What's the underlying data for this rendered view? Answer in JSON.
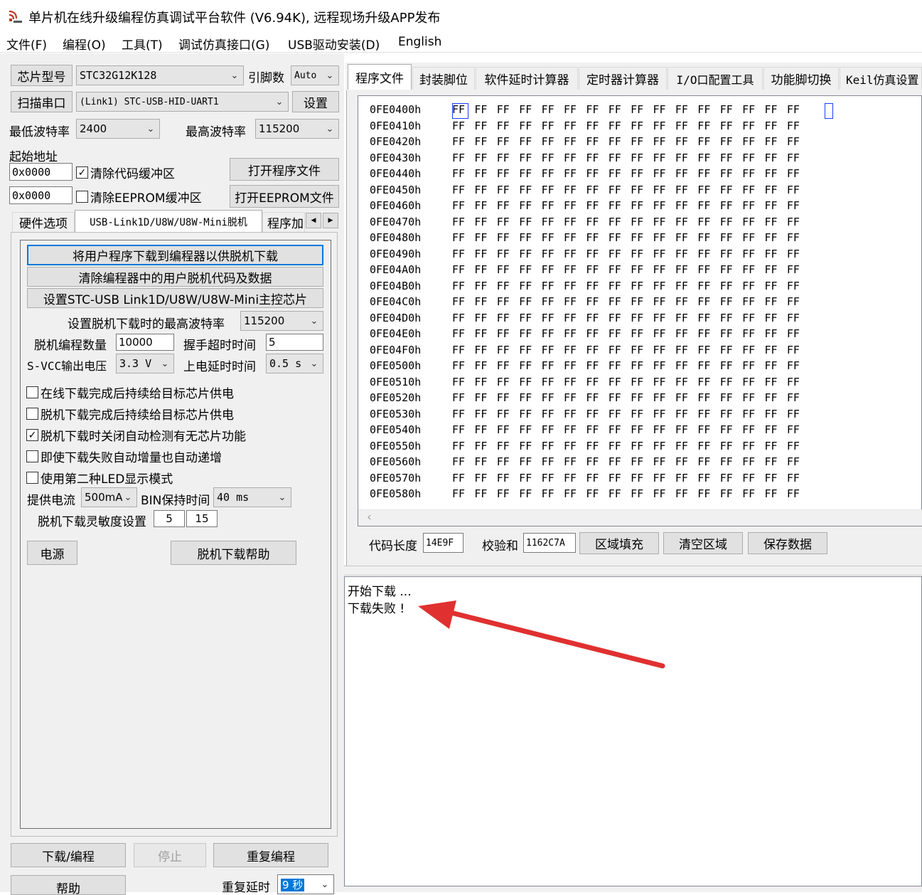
{
  "window": {
    "title": "单片机在线升级编程仿真调试平台软件 (V6.94K), 远程现场升级APP发布",
    "icon": "app-icon"
  },
  "menu": [
    "文件(F)",
    "编程(O)",
    "工具(T)",
    "调试仿真接口(G)",
    "USB驱动安装(D)",
    "English"
  ],
  "left": {
    "chip_model_button": "芯片型号",
    "chip_model": "STC32G12K128",
    "pin_count_label": "引脚数",
    "pin_count": "Auto",
    "scan_port_button": "扫描串口",
    "port": "(Link1) STC-USB-HID-UART1",
    "settings_button": "设置",
    "min_baud_label": "最低波特率",
    "min_baud": "2400",
    "max_baud_label": "最高波特率",
    "max_baud": "115200",
    "start_addr_label": "起始地址",
    "code_addr": "0x0000",
    "clear_code_buffer": "清除代码缓冲区",
    "open_program_button": "打开程序文件",
    "eeprom_addr": "0x0000",
    "clear_eeprom_buffer": "清除EEPROM缓冲区",
    "open_eeprom_button": "打开EEPROM文件",
    "tabs": [
      "硬件选项",
      "USB-Link1D/U8W/U8W-Mini脱机",
      "程序加"
    ],
    "offline": {
      "download_to_programmer": "将用户程序下载到编程器以供脱机下载",
      "clear_programmer": "清除编程器中的用户脱机代码及数据",
      "set_master_chip": "设置STC-USB Link1D/U8W/U8W-Mini主控芯片",
      "max_baud_label": "设置脱机下载时的最高波特率",
      "max_baud": "115200",
      "count_label": "脱机编程数量",
      "count": "10000",
      "handshake_label": "握手超时时间",
      "handshake": "5",
      "svcc_label": "S-VCC输出电压",
      "svcc": "3.3 V",
      "power_delay_label": "上电延时时间",
      "power_delay": "0.5 s",
      "options": [
        {
          "label": "在线下载完成后持续给目标芯片供电",
          "checked": false
        },
        {
          "label": "脱机下载完成后持续给目标芯片供电",
          "checked": false
        },
        {
          "label": "脱机下载时关闭自动检测有无芯片功能",
          "checked": true
        },
        {
          "label": "即使下载失败自动增量也自动递增",
          "checked": false
        },
        {
          "label": "使用第二种LED显示模式",
          "checked": false
        }
      ],
      "current_label": "提供电流",
      "current": "500mA",
      "bin_hold_label": "BIN保持时间",
      "bin_hold": "40 ms",
      "sensitivity_label": "脱机下载灵敏度设置",
      "sens_a": "5",
      "sens_b": "15",
      "power_button": "电源",
      "help_button": "脱机下载帮助"
    },
    "download_button": "下载/编程",
    "stop_button": "停止",
    "repeat_button": "重复编程",
    "help_button": "帮助",
    "repeat_delay_label": "重复延时",
    "repeat_delay": "9 秒"
  },
  "right": {
    "tabs": [
      "程序文件",
      "封装脚位",
      "软件延时计算器",
      "定时器计算器",
      "I/O口配置工具",
      "功能脚切换",
      "Keil仿真设置"
    ],
    "hex_rows": [
      "0FE0400h",
      "0FE0410h",
      "0FE0420h",
      "0FE0430h",
      "0FE0440h",
      "0FE0450h",
      "0FE0460h",
      "0FE0470h",
      "0FE0480h",
      "0FE0490h",
      "0FE04A0h",
      "0FE04B0h",
      "0FE04C0h",
      "0FE04D0h",
      "0FE04E0h",
      "0FE04F0h",
      "0FE0500h",
      "0FE0510h",
      "0FE0520h",
      "0FE0530h",
      "0FE0540h",
      "0FE0550h",
      "0FE0560h",
      "0FE0570h",
      "0FE0580h"
    ],
    "byte_value": "FF",
    "code_length_label": "代码长度",
    "code_length": "14E9F",
    "checksum_label": "校验和",
    "checksum": "1162C7A",
    "fill_button": "区域填充",
    "clear_button": "清空区域",
    "save_button": "保存数据",
    "log": [
      "开始下载 ...",
      "下载失败 !"
    ]
  },
  "colors": {
    "arrow": "#e03030",
    "focus": "#0078d7"
  }
}
